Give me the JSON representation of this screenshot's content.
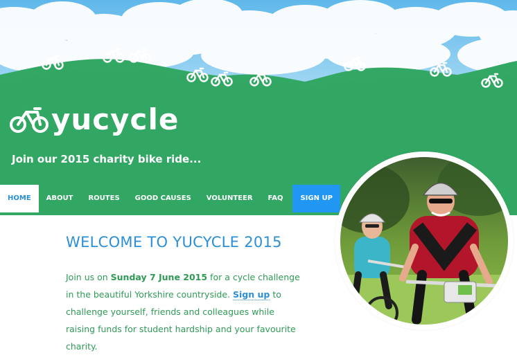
{
  "brand": {
    "name": "yucycle",
    "tagline": "Join our 2015 charity bike ride..."
  },
  "nav": {
    "items": [
      {
        "label": "HOME"
      },
      {
        "label": "ABOUT"
      },
      {
        "label": "ROUTES"
      },
      {
        "label": "GOOD CAUSES"
      },
      {
        "label": "VOLUNTEER"
      },
      {
        "label": "FAQ"
      },
      {
        "label": "SIGN UP"
      }
    ]
  },
  "main": {
    "heading": "WELCOME TO YUCYCLE 2015",
    "intro_before": "Join us on ",
    "intro_date": "Sunday 7 June 2015",
    "intro_middle": " for a cycle challenge in the beautiful Yorkshire countryside. ",
    "intro_link": "Sign up",
    "intro_after": " to challenge yourself, friends and colleagues while raising funds for student hardship and your favourite charity."
  },
  "colors": {
    "green": "#33a864",
    "blue": "#2196f3",
    "sky": "#7ec7ef",
    "text_green": "#2e9a55",
    "link_blue": "#2a8fd6"
  },
  "icons": [
    "bicycle-icon"
  ]
}
